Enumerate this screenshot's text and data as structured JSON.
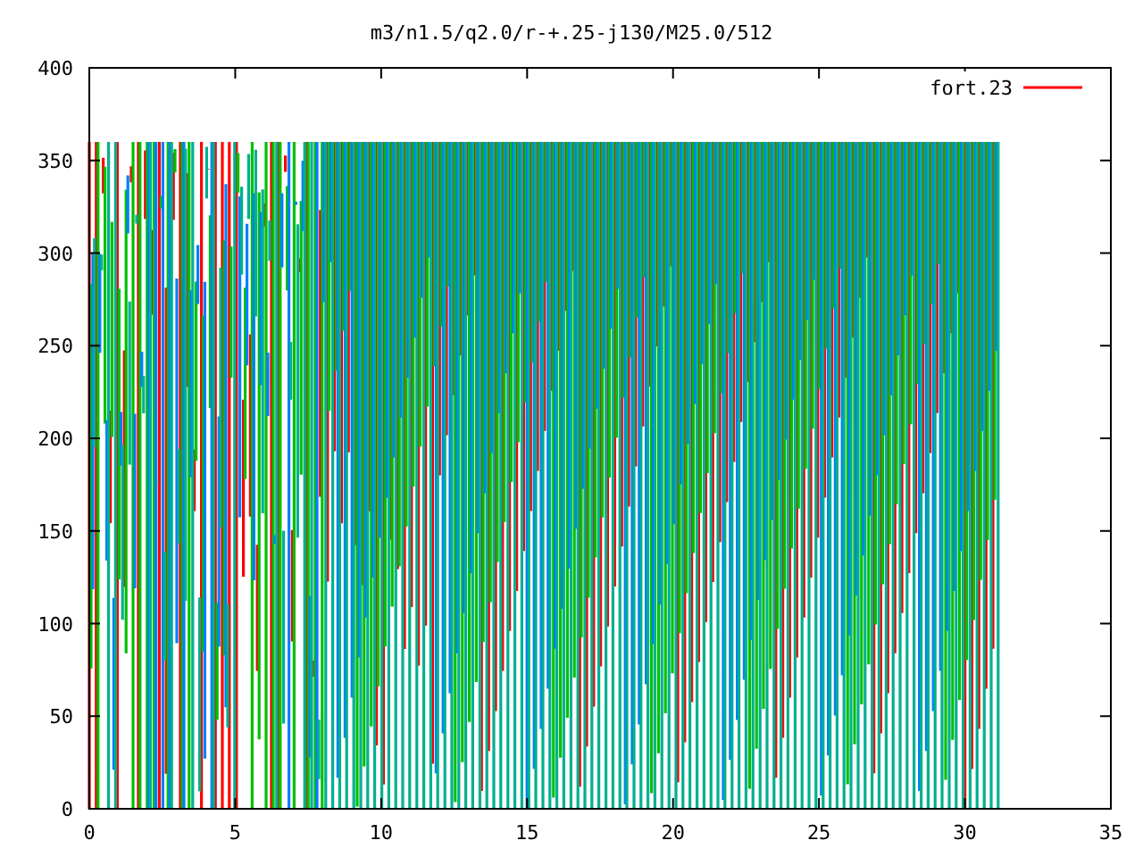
{
  "title": "m3/n1.5/q2.0/r-+.25-j130/M25.0/512",
  "x_axis": {
    "ticks": [
      "0",
      "5",
      "10",
      "15",
      "20",
      "25",
      "30",
      "35"
    ]
  },
  "y_axis": {
    "ticks": [
      "400",
      "350",
      "300",
      "250",
      "200",
      "150",
      "100",
      "50",
      "0"
    ]
  },
  "legend": {
    "label": "fort.23"
  }
}
